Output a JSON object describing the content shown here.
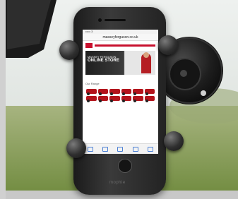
{
  "scene": {
    "background_colors": {
      "sky": "#dfe5e1",
      "grass": "#8ea35b",
      "mount_black": "#161616"
    }
  },
  "phone": {
    "status_text": "••••• 3",
    "url": "masseyferguson.co.uk",
    "banner_line1": "MASSEY FERGUSON",
    "banner_line2": "ONLINE STORE",
    "section_title": "Our Range",
    "brand": "mophie"
  }
}
